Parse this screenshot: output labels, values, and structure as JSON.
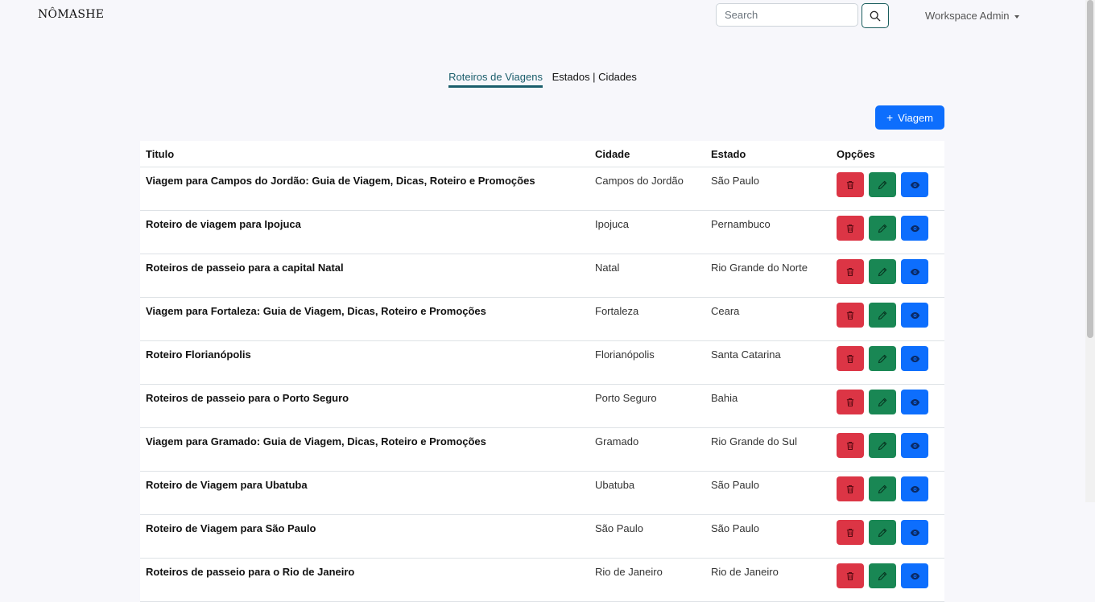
{
  "navbar": {
    "brand": "NÔMASHE",
    "search_placeholder": "Search",
    "admin_label": "Workspace Admin"
  },
  "tabs": [
    {
      "label": "Roteiros de Viagens",
      "active": true
    },
    {
      "label": "Estados | Cidades",
      "active": false
    }
  ],
  "add_button": {
    "label": "Viagem",
    "icon": "plus-icon"
  },
  "table": {
    "columns": [
      "Titulo",
      "Cidade",
      "Estado",
      "Opções"
    ],
    "rows": [
      {
        "title": "Viagem para Campos do Jordão: Guia de Viagem, Dicas, Roteiro e Promoções",
        "city": "Campos do Jordão",
        "state": "São Paulo"
      },
      {
        "title": "Roteiro de viagem para Ipojuca",
        "city": "Ipojuca",
        "state": "Pernambuco"
      },
      {
        "title": "Roteiros de passeio para a capital Natal",
        "city": "Natal",
        "state": "Rio Grande do Norte"
      },
      {
        "title": "Viagem para Fortaleza: Guia de Viagem, Dicas, Roteiro e Promoções",
        "city": "Fortaleza",
        "state": "Ceara"
      },
      {
        "title": "Roteiro Florianópolis",
        "city": "Florianópolis",
        "state": "Santa Catarina"
      },
      {
        "title": "Roteiros de passeio para o Porto Seguro",
        "city": "Porto Seguro",
        "state": "Bahia"
      },
      {
        "title": "Viagem para Gramado: Guia de Viagem, Dicas, Roteiro e Promoções",
        "city": "Gramado",
        "state": "Rio Grande do Sul"
      },
      {
        "title": "Roteiro de Viagem para Ubatuba",
        "city": "Ubatuba",
        "state": "São Paulo"
      },
      {
        "title": "Roteiro de Viagem para São Paulo",
        "city": "São Paulo",
        "state": "São Paulo"
      },
      {
        "title": "Roteiros de passeio para o Rio de Janeiro",
        "city": "Rio de Janeiro",
        "state": "Rio de Janeiro"
      }
    ],
    "action_icons": [
      "trash-icon",
      "pencil-icon",
      "eye-icon"
    ]
  },
  "colors": {
    "primary": "#0d6efd",
    "danger": "#dc3545",
    "success": "#198754",
    "accent": "#1a5d6b",
    "background": "#f7f7fb"
  }
}
